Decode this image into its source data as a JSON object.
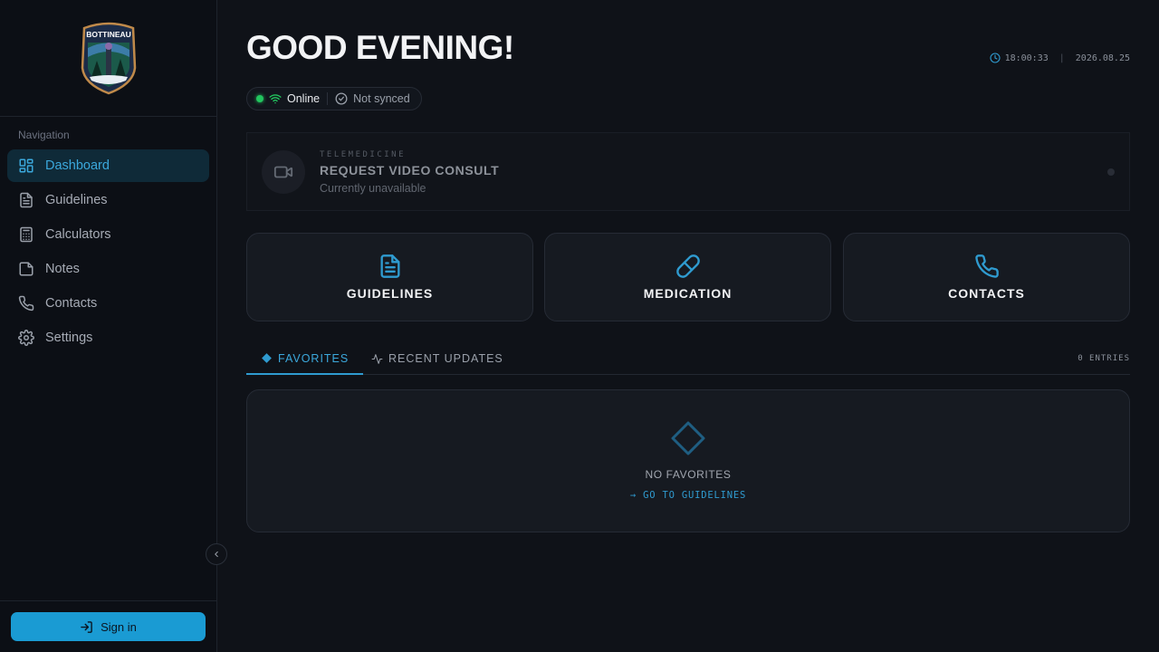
{
  "sidebar": {
    "logo_alt": "Bottineau Ambulance Service badge",
    "logo_text": "BOTTINEAU",
    "nav_heading": "Navigation",
    "items": [
      {
        "label": "Dashboard",
        "icon": "dashboard-icon",
        "active": true
      },
      {
        "label": "Guidelines",
        "icon": "file-text-icon"
      },
      {
        "label": "Calculators",
        "icon": "calculator-icon"
      },
      {
        "label": "Notes",
        "icon": "note-icon"
      },
      {
        "label": "Contacts",
        "icon": "phone-icon"
      },
      {
        "label": "Settings",
        "icon": "gear-icon"
      }
    ],
    "signin_label": "Sign in"
  },
  "header": {
    "greeting": "GOOD EVENING!",
    "time": "18:00:33",
    "date": "2026.08.25"
  },
  "status": {
    "online_label": "Online",
    "sync_label": "Not synced"
  },
  "telemedicine": {
    "eyebrow": "TELEMEDICINE",
    "title": "REQUEST VIDEO CONSULT",
    "subtitle": "Currently unavailable"
  },
  "quick_actions": [
    {
      "label": "GUIDELINES",
      "icon": "file-text-icon"
    },
    {
      "label": "MEDICATION",
      "icon": "pill-icon"
    },
    {
      "label": "CONTACTS",
      "icon": "phone-icon"
    }
  ],
  "tabs": {
    "favorites": "FAVORITES",
    "recent": "RECENT UPDATES",
    "entries": "0 ENTRIES"
  },
  "favorites_panel": {
    "empty_label": "NO FAVORITES",
    "link_label": "→ GO TO GUIDELINES"
  },
  "colors": {
    "accent": "#2f9bd0",
    "background": "#0f1218",
    "online": "#22c55e"
  }
}
